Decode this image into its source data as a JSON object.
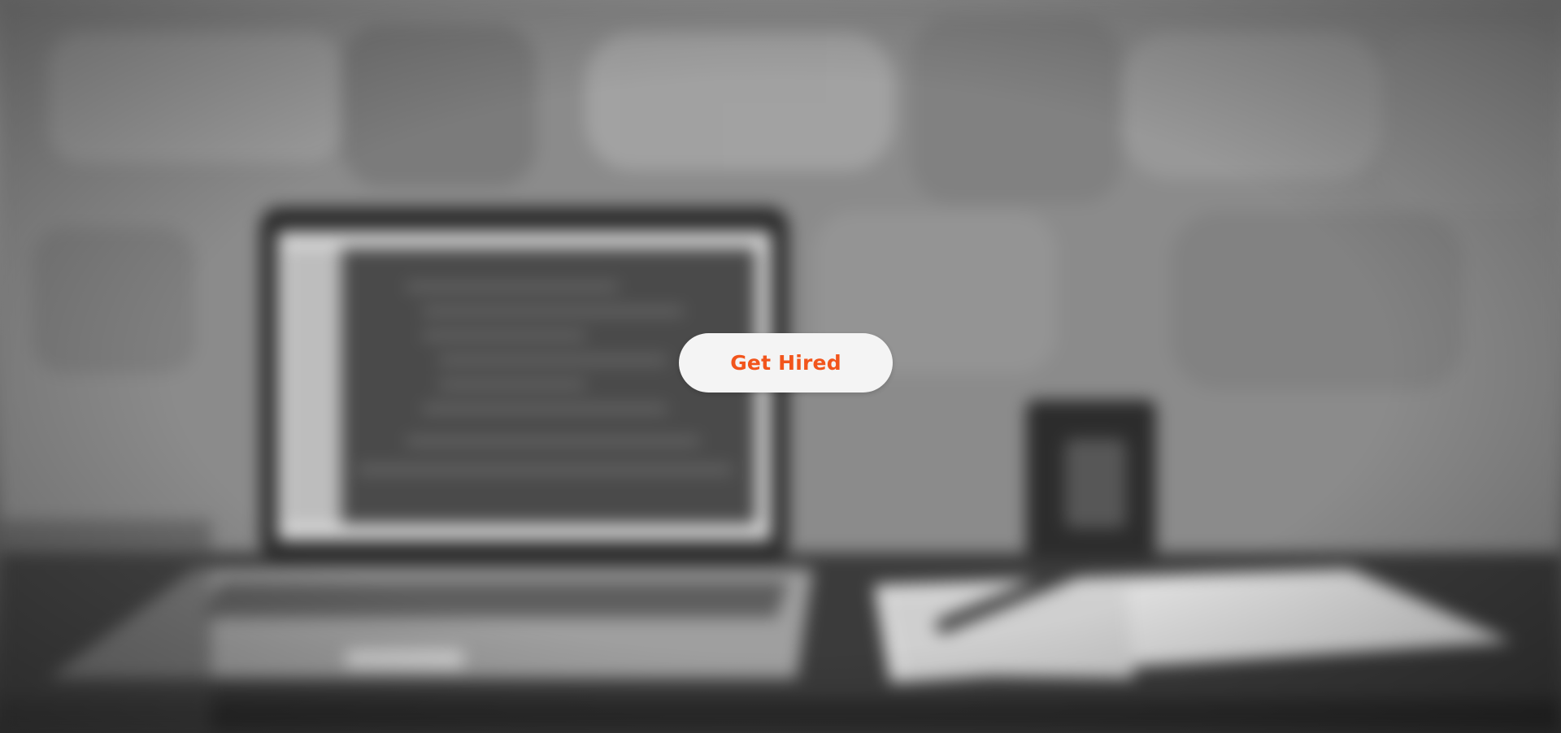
{
  "hero": {
    "cta_label": "Get Hired"
  },
  "colors": {
    "cta_text": "#f2551c",
    "cta_background": "#f4f4f4"
  }
}
